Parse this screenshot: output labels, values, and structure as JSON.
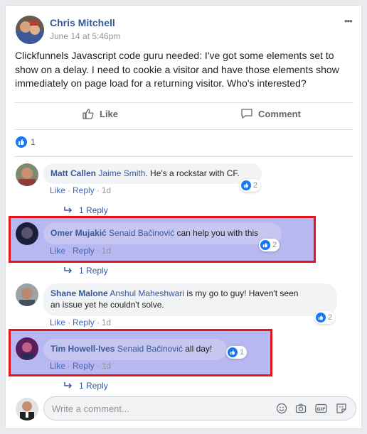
{
  "post": {
    "author": "Chris Mitchell",
    "timestamp": "June 14 at 5:46pm",
    "more_label": "•••",
    "text": "Clickfunnels Javascript code guru needed: I've got some elements set to show on a delay. I need to cookie a visitor and have those elements show immediately on page load for a returning visitor. Who's interested?",
    "like_label": "Like",
    "comment_label": "Comment",
    "reaction_count": "1"
  },
  "comments": [
    {
      "author": "Matt Callen",
      "mention": "Jaime Smith",
      "text": ". He's a rockstar with CF.",
      "like": "Like",
      "reply": "Reply",
      "age": "1d",
      "reactions": "2",
      "replies": "1 Reply"
    },
    {
      "author": "Omer Mujakić",
      "mention": "Senaid Bačinović",
      "text": " can help you with this",
      "like": "Like",
      "reply": "Reply",
      "age": "1d",
      "reactions": "2",
      "replies": "1 Reply"
    },
    {
      "author": "Shane Malone",
      "mention": "Anshul Maheshwari",
      "text_line1": " is my go to guy! Haven't seen",
      "text_line2": "an issue yet he couldn't solve.",
      "like": "Like",
      "reply": "Reply",
      "age": "1d",
      "reactions": "2"
    },
    {
      "author": "Tim Howell-Ives",
      "mention": "Senaid Bačinović",
      "text": " all day!",
      "like": "Like",
      "reply": "Reply",
      "age": "1d",
      "reactions": "1",
      "replies": "1 Reply"
    }
  ],
  "composer": {
    "placeholder": "Write a comment..."
  },
  "icons": [
    "thumbs-up-icon",
    "comment-icon",
    "reply-arrow-icon",
    "emoji-icon",
    "camera-icon",
    "gif-icon",
    "sticker-icon"
  ]
}
